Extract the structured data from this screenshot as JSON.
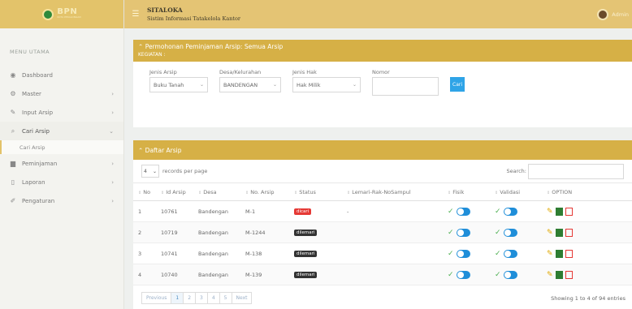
{
  "brand": {
    "logo_text": "BPN",
    "logo_sub": "KOTA PEKALONGAN"
  },
  "topbar": {
    "title": "SITALOKA",
    "subtitle": "Sistim Informasi Tatakelola Kantor",
    "user": "Admin"
  },
  "sidebar": {
    "menu_title": "MENU UTAMA",
    "items": [
      {
        "label": "Dashboard",
        "icon": "dashboard-icon",
        "glyph": "◉"
      },
      {
        "label": "Master",
        "icon": "gear-icon",
        "glyph": "⚙",
        "arrow": "›"
      },
      {
        "label": "Input Arsip",
        "icon": "pencil-icon",
        "glyph": "✎",
        "arrow": "›"
      },
      {
        "label": "Cari Arsip",
        "icon": "search-icon",
        "glyph": "⌕",
        "arrow": "⌄"
      },
      {
        "label": "Peminjaman",
        "icon": "book-icon",
        "glyph": "▆",
        "arrow": "›"
      },
      {
        "label": "Laporan",
        "icon": "file-icon",
        "glyph": "▯",
        "arrow": "›"
      },
      {
        "label": "Pengaturan",
        "icon": "wrench-icon",
        "glyph": "✐",
        "arrow": "›"
      }
    ],
    "sub_item": "Cari Arsip"
  },
  "filter_panel": {
    "title": "Permohonan Peminjaman Arsip: Semua Arsip",
    "subtitle": "KEGIATAN :",
    "jenis_arsip": {
      "label": "Jenis Arsip",
      "value": "Buku Tanah"
    },
    "desa": {
      "label": "Desa/Kelurahan",
      "value": "BANDENGAN"
    },
    "jenis_hak": {
      "label": "Jenis Hak",
      "value": "Hak Milik"
    },
    "nomor": {
      "label": "Nomor",
      "value": ""
    },
    "button": "Cari"
  },
  "list_panel": {
    "title": "Daftar Arsip",
    "records_value": "4",
    "records_label": "records per page",
    "search_label": "Search:",
    "columns": [
      "No",
      "Id Arsip",
      "Desa",
      "No. Arsip",
      "Status",
      "Lemari-Rak-NoSampul",
      "Fisik",
      "Validasi",
      "OPTION"
    ],
    "rows": [
      {
        "no": "1",
        "id": "10761",
        "desa": "Bandengan",
        "no_arsip": "M-1",
        "status": "dicari",
        "status_color": "#e53935",
        "lemari": "-"
      },
      {
        "no": "2",
        "id": "10719",
        "desa": "Bandengan",
        "no_arsip": "M-1244",
        "status": "dilemari",
        "status_color": "#333333",
        "lemari": ""
      },
      {
        "no": "3",
        "id": "10741",
        "desa": "Bandengan",
        "no_arsip": "M-138",
        "status": "dilemari",
        "status_color": "#333333",
        "lemari": ""
      },
      {
        "no": "4",
        "id": "10740",
        "desa": "Bandengan",
        "no_arsip": "M-139",
        "status": "dilemari",
        "status_color": "#333333",
        "lemari": ""
      }
    ],
    "pager": [
      "Previous",
      "1",
      "2",
      "3",
      "4",
      "5",
      "Next"
    ],
    "showing": "Showing 1 to 4 of 94 entries"
  },
  "colors": {
    "gold": "#e4c474",
    "panel_gold": "#d6b046",
    "blue": "#2fa4e7"
  }
}
